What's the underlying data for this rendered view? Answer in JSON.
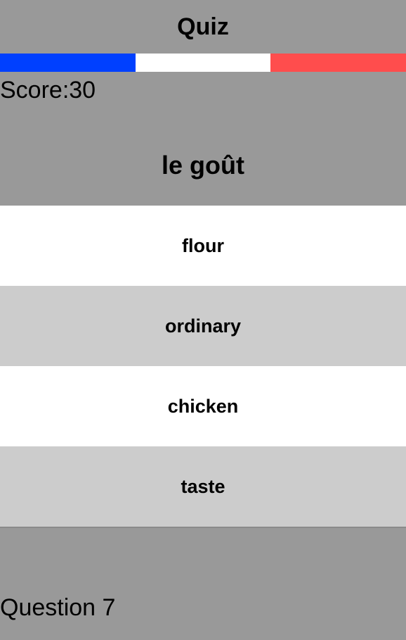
{
  "header": {
    "title": "Quiz"
  },
  "flag_colors": [
    "#0040ff",
    "#ffffff",
    "#ff4d4d"
  ],
  "score": {
    "label": "Score:",
    "value": "30"
  },
  "question": {
    "prompt": "le goût"
  },
  "answers": [
    {
      "label": "flour"
    },
    {
      "label": "ordinary"
    },
    {
      "label": "chicken"
    },
    {
      "label": "taste"
    }
  ],
  "footer": {
    "label": "Question",
    "number": "7"
  }
}
